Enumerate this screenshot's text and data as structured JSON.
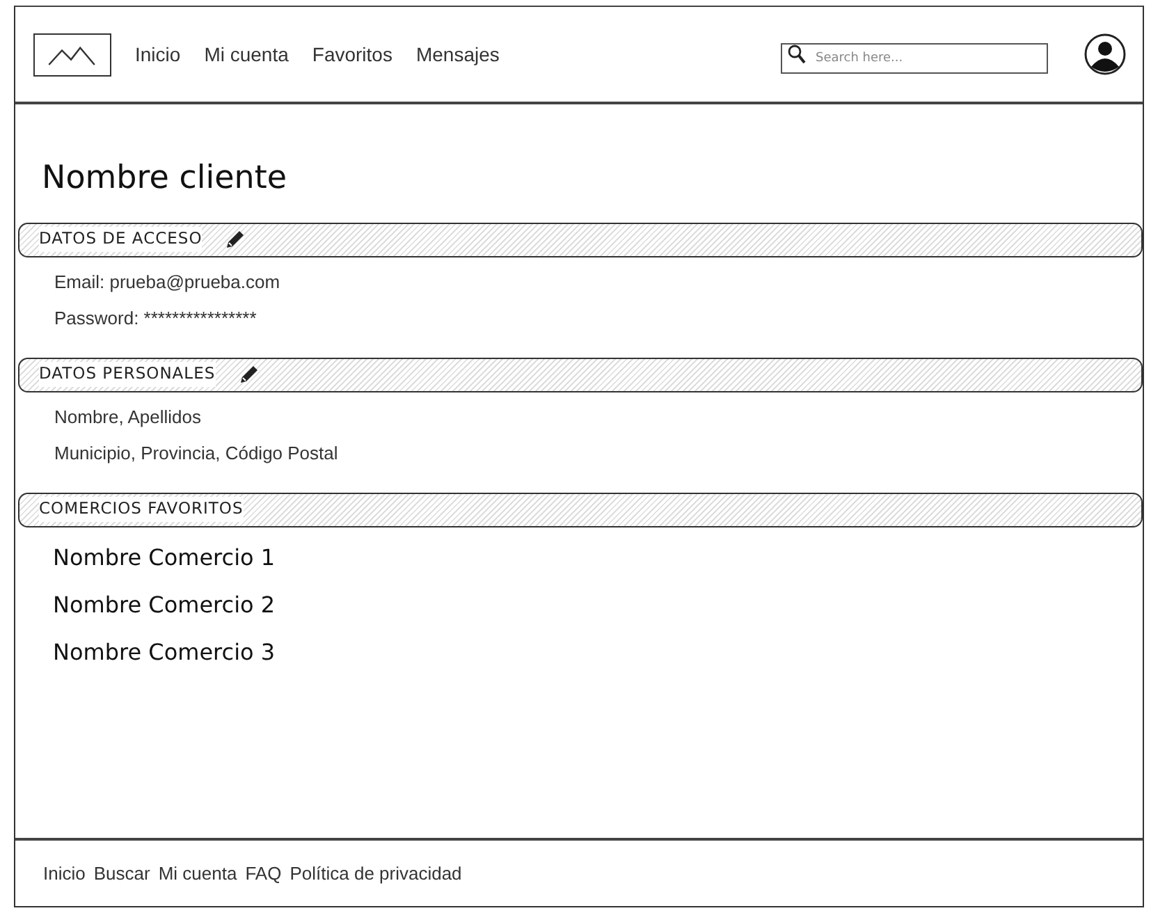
{
  "nav": {
    "links": [
      "Inicio",
      "Mi cuenta",
      "Favoritos",
      "Mensajes"
    ],
    "search": {
      "placeholder": "Search here..."
    }
  },
  "title": "Nombre cliente",
  "sections": [
    {
      "heading": "DATOS DE ACCESO",
      "editable": true,
      "kind": "details",
      "items": [
        "Email: prueba@prueba.com",
        "Password: ****************"
      ]
    },
    {
      "heading": "DATOS PERSONALES",
      "editable": true,
      "kind": "details",
      "items": [
        "Nombre, Apellidos",
        "Municipio, Provincia, Código Postal"
      ]
    },
    {
      "heading": "COMERCIOS FAVORITOS",
      "editable": false,
      "kind": "list",
      "items": [
        "Nombre Comercio 1",
        "Nombre Comercio 2",
        "Nombre Comercio 3"
      ]
    }
  ],
  "footer": {
    "links": [
      "Inicio",
      "Buscar",
      "Mi cuenta",
      "FAQ",
      "Política de privacidad"
    ]
  }
}
